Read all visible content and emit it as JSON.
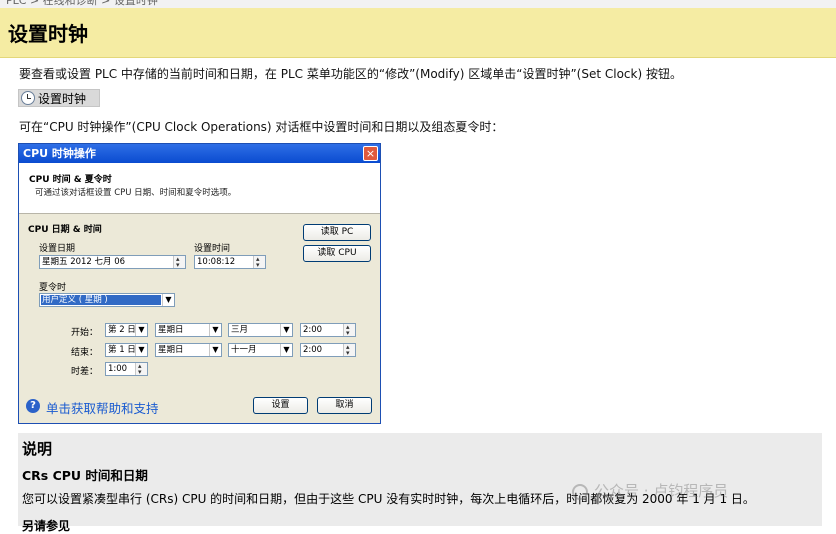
{
  "top_strip": "PLC > 在线和诊断 > 设置时钟",
  "page_title": "设置时钟",
  "intro_text": "要查看或设置 PLC 中存储的当前时间和日期，在 PLC 菜单功能区的“修改”(Modify) 区域单击“设置时钟”(Set Clock) 按钮。",
  "set_clock_button": "设置时钟",
  "dialog_intro": "可在“CPU 时钟操作”(CPU Clock Operations) 对话框中设置时间和日期以及组态夏令时：",
  "dialog": {
    "title": "CPU 时钟操作",
    "close": "×",
    "header_title": "CPU 时间 & 夏令时",
    "header_desc": "可通过该对话框设置 CPU 日期、时间和夏令时选项。",
    "section_title": "CPU 日期 & 时间",
    "set_date_label": "设置日期",
    "set_date_value": "星期五 2012  七月  06",
    "set_time_label": "设置时间",
    "set_time_value": "10:08:12",
    "read_pc": "读取 PC",
    "read_cpu": "读取 CPU",
    "dst_label": "夏令时",
    "dst_value": "用户定义 ( 星期 )",
    "start_label": "开始：",
    "start_week": "第 2 日",
    "start_day": "星期日",
    "start_month": "三月",
    "start_time": "2:00",
    "end_label": "结束：",
    "end_week": "第 1 日",
    "end_day": "星期日",
    "end_month": "十一月",
    "end_time": "2:00",
    "offset_label": "时差：",
    "offset_value": "1:00",
    "help_text": "单击获取帮助和支持",
    "set_button": "设置",
    "cancel_button": "取消"
  },
  "note": {
    "heading": "说明",
    "subheading": "CRs CPU 时间和日期",
    "body": "您可以设置紧凑型串行 (CRs) CPU 的时间和日期，但由于这些 CPU 没有实时时钟，每次上电循环后，时间都恢复为 2000 年 1 月 1 日。",
    "cut_text": "另请参见"
  },
  "watermark": "公众号 · 卢钧程序员"
}
